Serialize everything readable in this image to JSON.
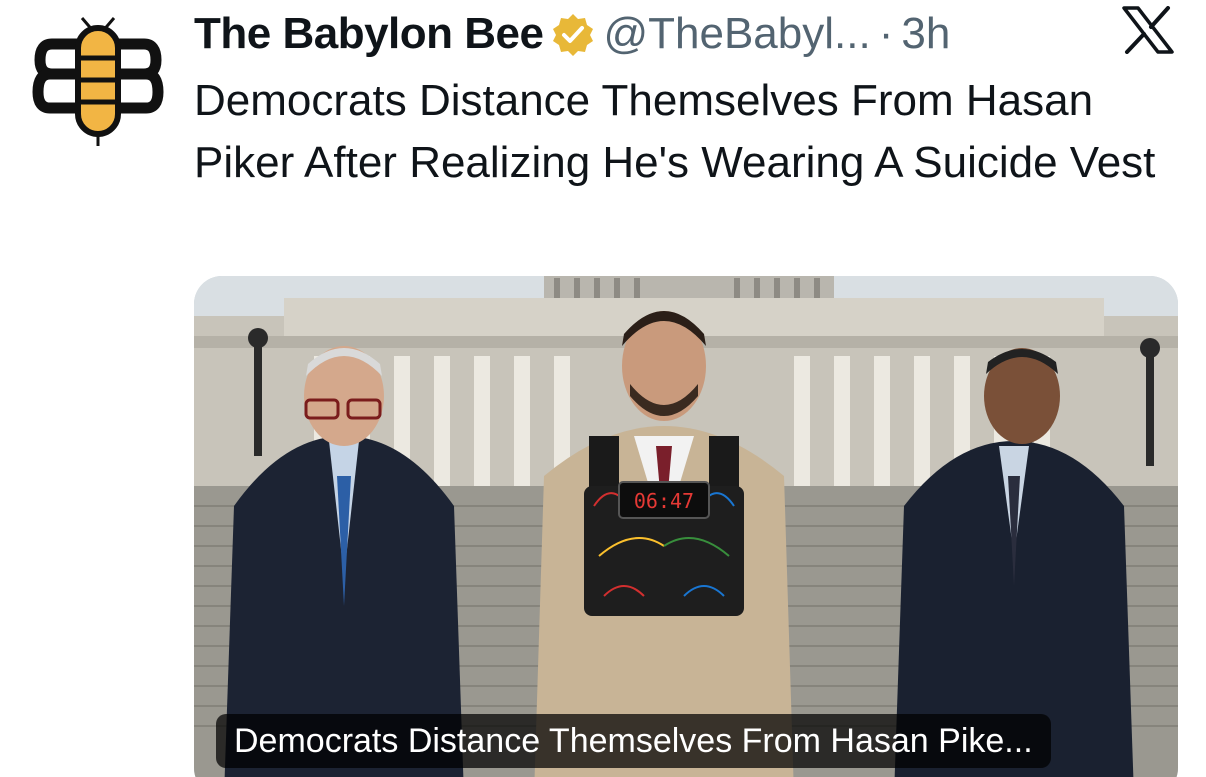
{
  "account": {
    "name": "The Babylon Bee",
    "handle": "@TheBabyl...",
    "separator": "·",
    "time": "3h",
    "avatar_icon": "babylon-bee-logo-icon",
    "verified_icon": "verified-badge-icon"
  },
  "tweet": {
    "text": "Democrats Distance Themselves From Hasan Piker After Realizing He's Wearing A Suicide Vest"
  },
  "card": {
    "caption": "Democrats Distance Themselves From Hasan Pike...",
    "vest_timer": "06:47"
  },
  "platform_icon": "x-logo-icon",
  "colors": {
    "bee_yellow": "#f2b544",
    "verified_gold": "#e8b838",
    "text_primary": "#0f1419",
    "text_secondary": "#536471"
  }
}
